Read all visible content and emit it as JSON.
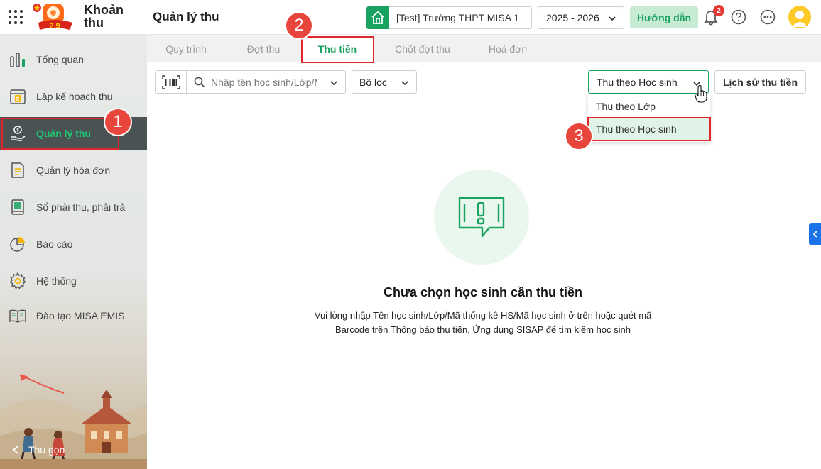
{
  "app": {
    "name_line1": "Khoản",
    "name_line2": "thu",
    "logo_text": "2.9"
  },
  "header": {
    "title": "Quản lý thu",
    "school": "[Test] Trường THPT MISA 1",
    "year": "2025 - 2026",
    "guide_label": "Hướng dẫn",
    "notification_count": "2",
    "colors": {
      "accent": "#1aa260",
      "badge": "#e53935"
    }
  },
  "sidebar": {
    "items": [
      {
        "label": "Tổng quan",
        "icon": "bar-chart-icon"
      },
      {
        "label": "Lập kế hoạch thu",
        "icon": "calendar-dollar-icon"
      },
      {
        "label": "Quản lý thu",
        "icon": "hand-coin-icon",
        "active": true
      },
      {
        "label": "Quản lý hóa đơn",
        "icon": "invoice-icon"
      },
      {
        "label": "Sổ phải thu, phải trả",
        "icon": "book-icon"
      },
      {
        "label": "Báo cáo",
        "icon": "pie-chart-icon"
      },
      {
        "label": "Hệ thống",
        "icon": "gear-icon"
      },
      {
        "label": "Đào tạo MISA EMIS",
        "icon": "open-book-icon"
      }
    ],
    "collapse_label": "Thu gọn"
  },
  "tabs": [
    {
      "label": "Quy trình"
    },
    {
      "label": "Đợt thu"
    },
    {
      "label": "Thu tiền",
      "active": true
    },
    {
      "label": "Chốt đợt thu"
    },
    {
      "label": "Hoá đơn"
    }
  ],
  "toolbar": {
    "search_placeholder": "Nhập tên học sinh/Lớp/Mã thống kê HS/Mã học sinh",
    "filter_label": "Bộ lọc",
    "mode_value": "Thu theo Học sinh",
    "mode_options": [
      "Thu theo Lớp",
      "Thu theo Học sinh"
    ],
    "history_label": "Lịch sử thu tiền"
  },
  "empty_state": {
    "title": "Chưa chọn học sinh cần thu tiền",
    "desc_line1": "Vui lòng nhập Tên học sinh/Lớp/Mã thống kê HS/Mã học sinh ở trên hoặc quét mã",
    "desc_line2": "Barcode trên Thông báo thu tiền, Ứng dụng SISAP để tìm kiếm học sinh"
  },
  "annotations": {
    "step1": "1",
    "step2": "2",
    "step3": "3"
  }
}
